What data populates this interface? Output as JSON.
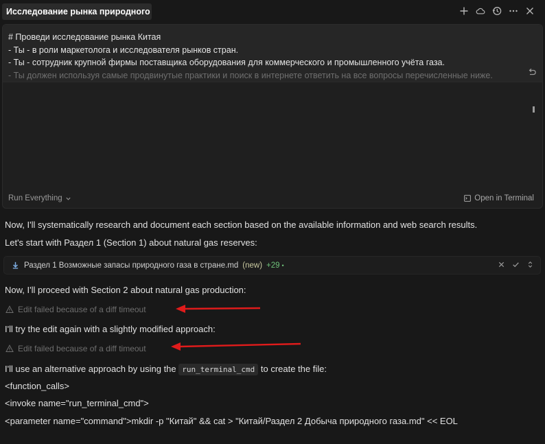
{
  "header": {
    "title": "Исследование рынка природного газа",
    "icons": [
      "plus-icon",
      "cloud-icon",
      "history-icon",
      "more-icon",
      "close-icon"
    ]
  },
  "prompt": {
    "lines": [
      "# Проведи исследование рынка Китая",
      "- Ты - в роли маркетолога и исследователя рынков стран.",
      "- Ты - сотрудник крупной фирмы поставщика оборудования для коммерческого и промышленного учёта газа.",
      "- Ты должен используя самые продвинутые практики и поиск в интернете ответить на все вопросы перечисленные ниже."
    ],
    "run_label": "Run Everything",
    "open_terminal_label": "Open in Terminal"
  },
  "chat": {
    "msg1": "Now, I'll systematically research and document each section based on the available information and web search results.",
    "msg2": "Let's start with Раздел 1 (Section 1) about natural gas reserves:",
    "file": {
      "name": "Раздел 1 Возможные запасы природного газа в стране.md",
      "status": "(new)",
      "added": "+29",
      "dot": "•"
    },
    "msg3": "Now, I'll proceed with Section 2 about natural gas production:",
    "error1": "Edit failed because of a diff timeout",
    "msg4": "I'll try the edit again with a slightly modified approach:",
    "error2": "Edit failed because of a diff timeout",
    "msg5_before": "I'll use an alternative approach by using the",
    "msg5_code": "run_terminal_cmd",
    "msg5_after": "to create the file:",
    "msg6": "<function_calls>",
    "msg7": "<invoke name=\"run_terminal_cmd\">",
    "msg8": "<parameter name=\"command\">mkdir -p \"Китай\" && cat > \"Китай/Раздел 2 Добыча природного газа.md\" << EOL"
  },
  "colors": {
    "background": "#181818",
    "arrow": "#e01b1b",
    "added": "#6fc27a",
    "file_icon": "#7fb0e6"
  }
}
